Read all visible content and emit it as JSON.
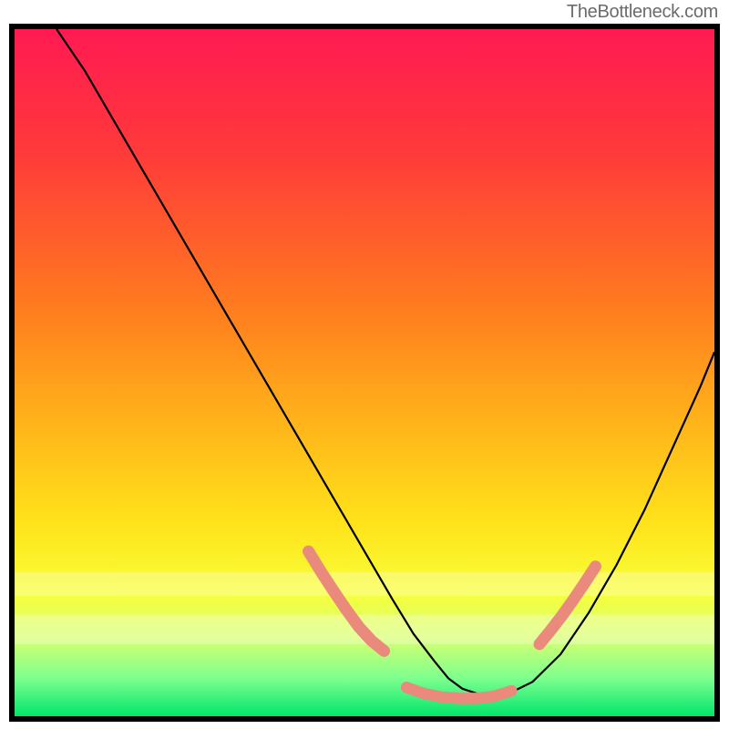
{
  "watermark": "TheBottleneck.com",
  "gradient_stops": [
    {
      "offset": 0.0,
      "color": "#ff1a52"
    },
    {
      "offset": 0.18,
      "color": "#ff3a3a"
    },
    {
      "offset": 0.4,
      "color": "#ff7a1f"
    },
    {
      "offset": 0.58,
      "color": "#ffb61a"
    },
    {
      "offset": 0.72,
      "color": "#ffe31a"
    },
    {
      "offset": 0.82,
      "color": "#f7ff3a"
    },
    {
      "offset": 0.885,
      "color": "#d8ff70"
    },
    {
      "offset": 0.945,
      "color": "#7dff8e"
    },
    {
      "offset": 1.0,
      "color": "#00e56b"
    }
  ],
  "haze_bands": [
    {
      "y": 0.79,
      "height": 0.035,
      "opacity": 0.28
    },
    {
      "y": 0.852,
      "height": 0.043,
      "opacity": 0.3
    }
  ],
  "chart_data": {
    "type": "line",
    "title": "",
    "xlabel": "",
    "ylabel": "",
    "xlim": [
      0,
      100
    ],
    "ylim": [
      0,
      100
    ],
    "series": [
      {
        "name": "bottleneck-curve",
        "color": "#000000",
        "width": 2.2,
        "x": [
          6,
          10,
          14,
          18,
          22,
          26,
          30,
          34,
          38,
          42,
          46,
          50,
          54,
          57,
          60,
          62,
          64,
          67,
          70,
          74,
          78,
          82,
          86,
          90,
          94,
          98,
          100
        ],
        "y": [
          100,
          94,
          87,
          80,
          73,
          66,
          59,
          52,
          45,
          38,
          31,
          24,
          17,
          12,
          8,
          5.5,
          4,
          3,
          3,
          5,
          9,
          15,
          22,
          30,
          39,
          48,
          53
        ]
      },
      {
        "name": "fit-markers-left",
        "color": "#e98a7d",
        "cap": "round",
        "width": 13,
        "x": [
          42.0,
          43.8,
          45.6,
          47.4,
          49.2,
          51.0,
          52.8
        ],
        "y": [
          24.0,
          21.0,
          18.2,
          15.5,
          13.0,
          11.0,
          9.5
        ]
      },
      {
        "name": "fit-markers-bottom",
        "color": "#e98a7d",
        "cap": "round",
        "width": 12.5,
        "x": [
          56.0,
          58.5,
          61.0,
          63.5,
          66.0,
          68.5,
          71.0
        ],
        "y": [
          4.2,
          3.3,
          2.8,
          2.6,
          2.6,
          2.9,
          3.7
        ]
      },
      {
        "name": "fit-markers-right",
        "color": "#e98a7d",
        "cap": "round",
        "width": 13,
        "x": [
          75.0,
          76.6,
          78.2,
          79.8,
          81.4,
          83.0
        ],
        "y": [
          10.5,
          12.5,
          14.6,
          16.9,
          19.3,
          21.8
        ]
      }
    ]
  }
}
